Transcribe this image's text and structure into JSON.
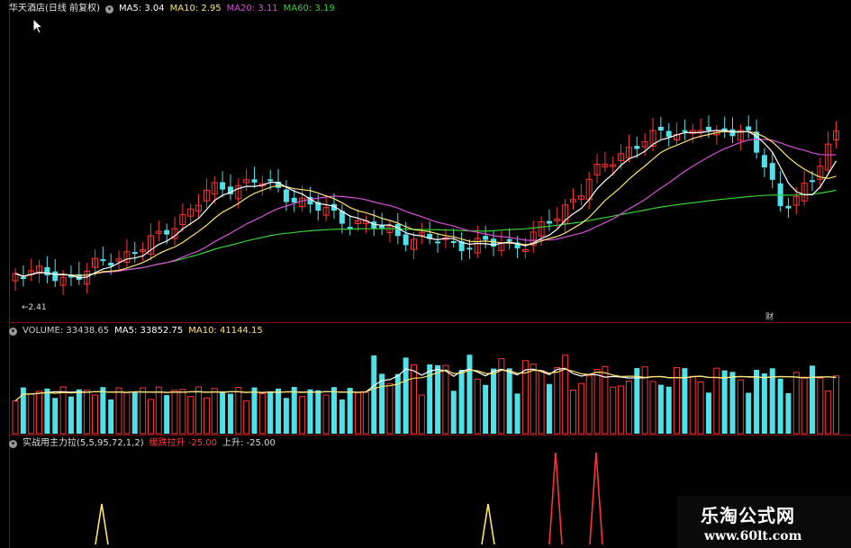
{
  "price_panel": {
    "title": "华天酒店(日线 前复权)",
    "indicators": [
      {
        "label": "MA5: 3.04",
        "color": "#ffffff"
      },
      {
        "label": "MA10: 2.95",
        "color": "#ffe36b"
      },
      {
        "label": "MA20: 3.11",
        "color": "#d84fd8"
      },
      {
        "label": "MA60: 3.19",
        "color": "#37d237"
      }
    ],
    "low_marker": "←2.41",
    "event_marker": "财"
  },
  "volume_panel": {
    "title": "VOLUME: 33438.65",
    "ma5": "MA5: 33852.75",
    "ma10": "MA10: 41144.15",
    "title_color": "#cccccc",
    "ma5_color": "#ffffff",
    "ma10_color": "#ffe36b"
  },
  "signal_panel": {
    "title": "实战用主力拉(5,5,95,72,1,2)",
    "item1": "缓跌拉升 -25.00",
    "item2": "上升: -25.00",
    "item1_color": "#ff3a3a",
    "item2_color": "#dddddd"
  },
  "watermark": {
    "brand": "乐淘公式网",
    "url": "www.60lt.com"
  },
  "colors": {
    "up": "#ff3333",
    "down": "#4fe0e8",
    "ma5": "#ffffff",
    "ma10": "#ffe36b",
    "ma20": "#d84fd8",
    "ma60": "#37d237",
    "separator": "#7a1010"
  }
}
